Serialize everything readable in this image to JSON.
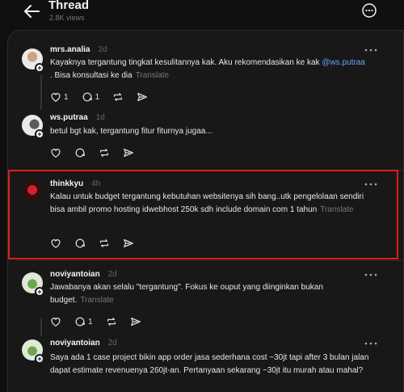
{
  "header": {
    "title": "Thread",
    "views": "2.8K views"
  },
  "posts": [
    {
      "username": "mrs.analia",
      "time": "2d",
      "text_before": "Kayaknya tergantung tingkat kesulitannya kak. Aku rekomendasikan ke kak ",
      "mention": "@ws.putraa",
      "text_after": " . Bisa konsultasi ke dia",
      "translate": "Translate",
      "like_count": "1",
      "reply_count": "1"
    },
    {
      "username": "ws.putraa",
      "time": "1d",
      "text": "betul bgt kak, tergantung fitur fiturnya jugaa...",
      "translate": ""
    },
    {
      "username": "thinkkyu",
      "time": "4h",
      "text": "Kalau untuk budget tergantung kebutuhan websitenya sih bang..utk pengelolaan sendiri bisa ambil promo hosting idwebhost 250k sdh include domain com 1 tahun",
      "translate": "Translate"
    },
    {
      "username": "noviyantoian",
      "time": "2d",
      "text": "Jawabanya akan selalu \"tergantung\". Fokus ke ouput yang diinginkan bukan budget.",
      "translate": "Translate",
      "reply_count": "1"
    },
    {
      "username": "noviyantoian",
      "time": "2d",
      "text": "Saya ada 1 case project bikin app order jasa sederhana cost ~30jt tapi after 3 bulan jalan dapat estimate revenuenya 260jt-an. Pertanyaan sekarang ~30jt itu murah atau mahal?",
      "translate": ""
    }
  ],
  "colors": {
    "highlight": "#e21b1b",
    "mention": "#6aa4ff",
    "background": "#101010",
    "panel": "#181818"
  }
}
